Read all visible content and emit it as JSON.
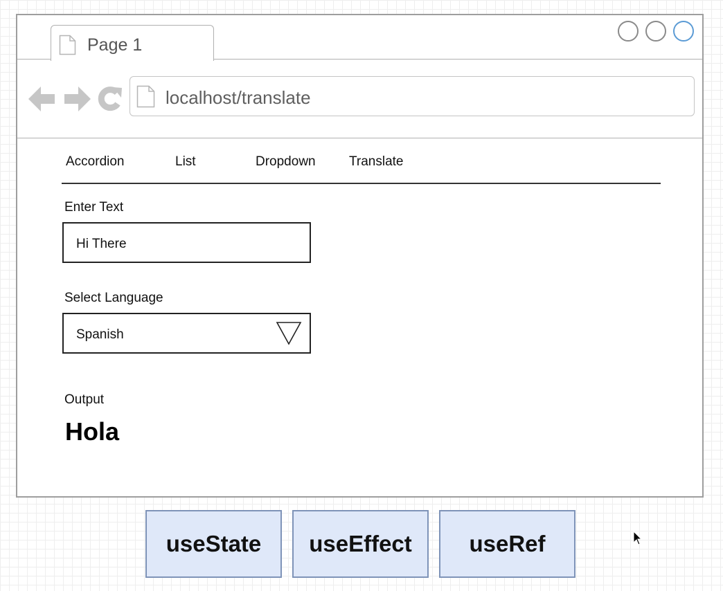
{
  "browser": {
    "tab_title": "Page 1",
    "address": "localhost/translate",
    "icons": {
      "back": "arrow-left-icon",
      "forward": "arrow-right-icon",
      "reload": "reload-icon",
      "page": "document-icon"
    },
    "colors": {
      "chrome_icon": "#c6c6c6",
      "active_window_control": "#5b9bd5"
    }
  },
  "nav": {
    "items": [
      "Accordion",
      "List",
      "Dropdown",
      "Translate"
    ]
  },
  "form": {
    "text_label": "Enter Text",
    "text_value": "Hi There",
    "language_label": "Select Language",
    "language_value": "Spanish",
    "output_label": "Output",
    "output_value": "Hola"
  },
  "hooks": [
    "useState",
    "useEffect",
    "useRef"
  ],
  "colors": {
    "hook_fill": "#dfe8f9",
    "hook_border": "#7e93b8"
  }
}
